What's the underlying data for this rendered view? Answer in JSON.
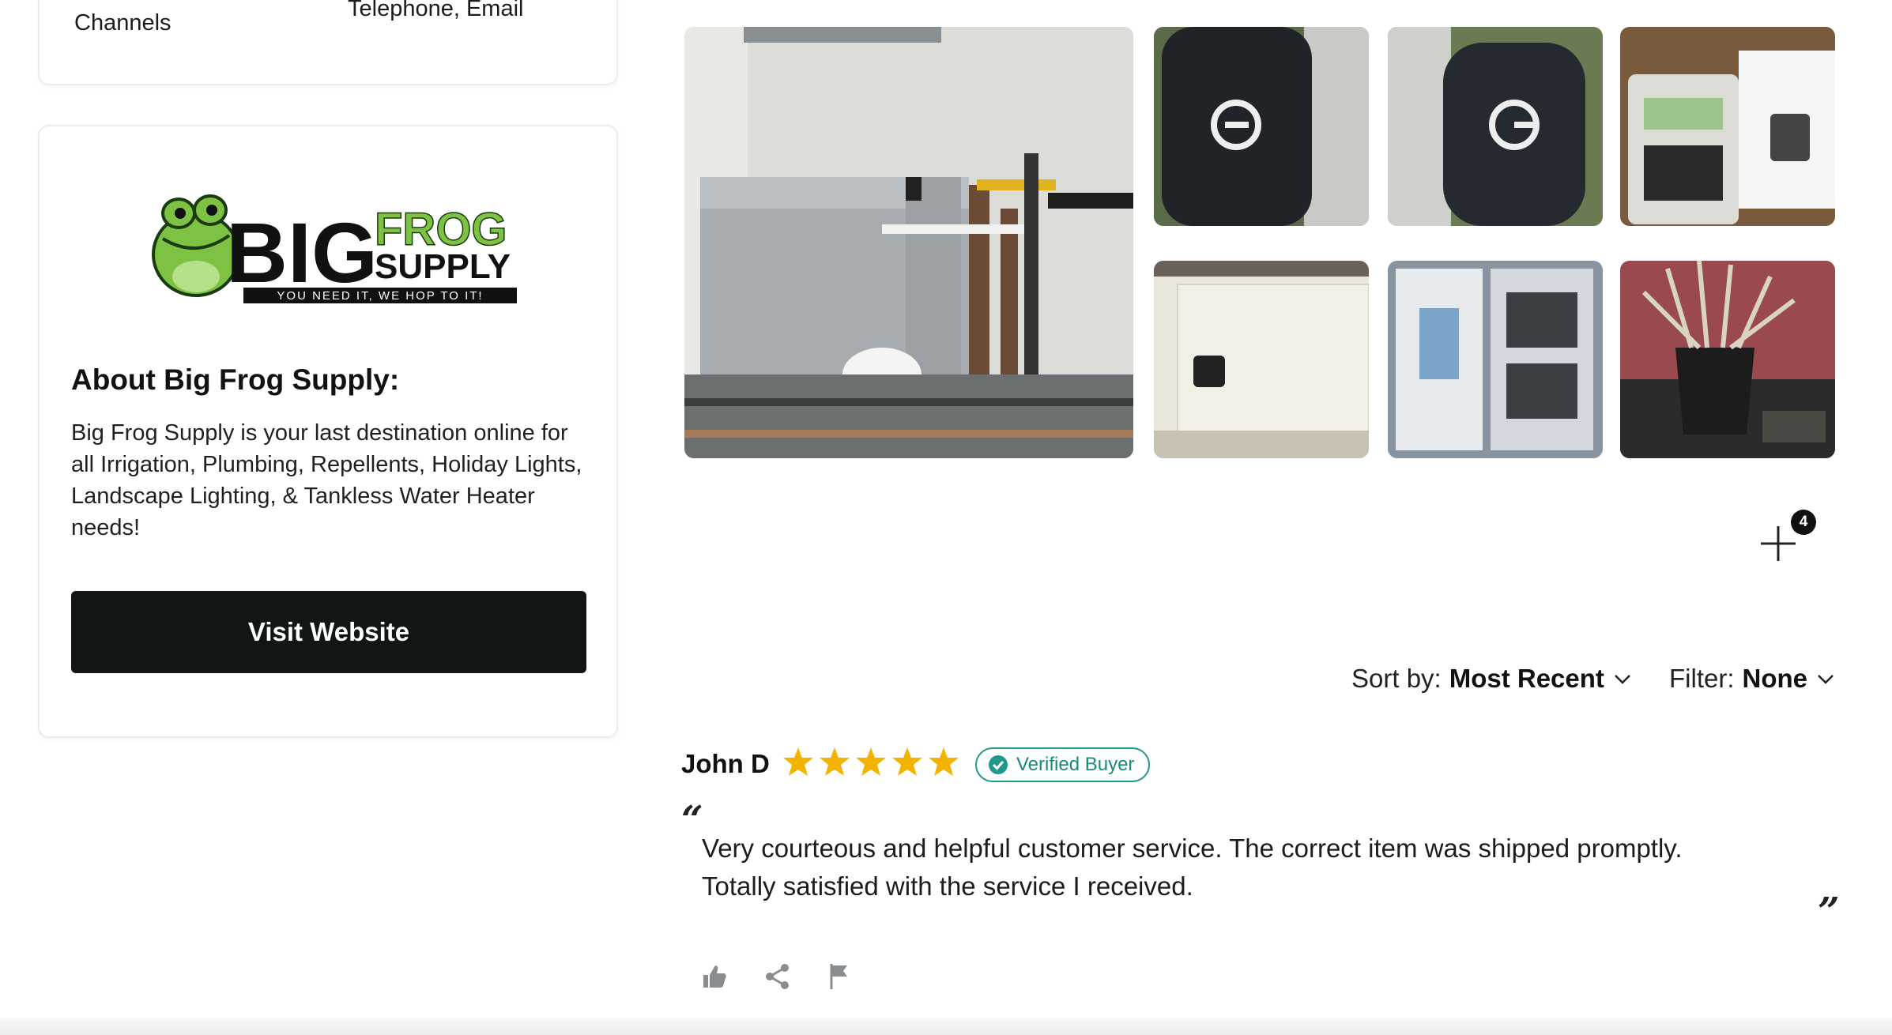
{
  "contact": {
    "label": "Channels",
    "value": "Telephone, Email"
  },
  "about": {
    "logo_text": {
      "big": "BIG",
      "frog": "FROG",
      "supply": "SUPPLY",
      "tagline": "YOU NEED IT, WE HOP TO IT!"
    },
    "title": "About Big Frog Supply:",
    "description": "Big Frog Supply is your last destination online for all Irrigation, Plumbing, Repellents, Holiday Lights, Landscape Lighting, & Tankless Water Heater needs!",
    "visit_label": "Visit Website"
  },
  "gallery": {
    "more_count": "4",
    "photos": [
      "tankless-water-heater",
      "grill-cover-1",
      "grill-cover-2",
      "irrigation-controller",
      "wall-device",
      "controller-panel",
      "brush-holder"
    ]
  },
  "sort": {
    "sort_label": "Sort by:",
    "sort_value": "Most Recent",
    "filter_label": "Filter:",
    "filter_value": "None"
  },
  "review": {
    "name": "John D",
    "rating": 5,
    "verified_label": "Verified Buyer",
    "text": "Very courteous and helpful customer service.  The correct item was shipped promptly.\nTotally satisfied with the service I received.",
    "open_quote": "“",
    "close_quote": "”"
  },
  "colors": {
    "button": "#111515",
    "star": "#f5b301",
    "verified": "#1f9a8a",
    "frog_green": "#7dc242"
  }
}
